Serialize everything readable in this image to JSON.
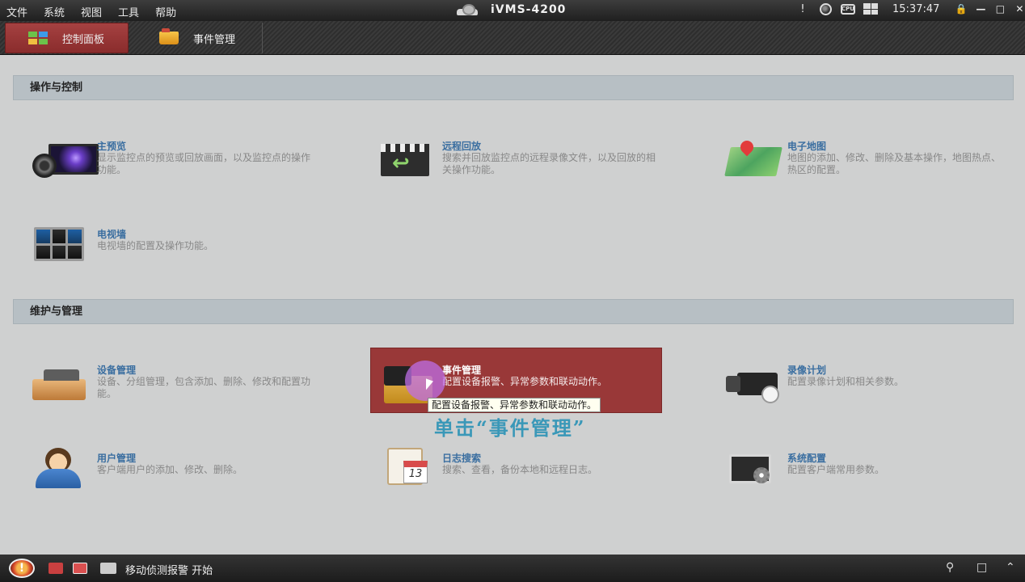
{
  "titlebar": {
    "menu": [
      "文件",
      "系统",
      "视图",
      "工具",
      "帮助"
    ],
    "app_name": "iVMS-4200",
    "alert_mark": "!",
    "cpu_label": "CPU",
    "time": "15:37:47"
  },
  "tabs": [
    {
      "label": "控制面板",
      "active": true,
      "icon": "grid-icon"
    },
    {
      "label": "事件管理",
      "active": false,
      "icon": "folder-icon"
    }
  ],
  "sections": [
    {
      "header": "操作与控制",
      "items": [
        {
          "title": "主预览",
          "desc": "显示监控点的预览或回放画面，以及监控点的操作功能。",
          "icon": "main-preview-icon"
        },
        {
          "title": "远程回放",
          "desc": "搜索并回放监控点的远程录像文件，以及回放的相关操作功能。",
          "icon": "remote-playback-icon"
        },
        {
          "title": "电子地图",
          "desc": "地图的添加、修改、删除及基本操作，地图热点、热区的配置。",
          "icon": "emap-icon"
        },
        {
          "title": "电视墙",
          "desc": "电视墙的配置及操作功能。",
          "icon": "tv-wall-icon"
        }
      ]
    },
    {
      "header": "维护与管理",
      "items": [
        {
          "title": "设备管理",
          "desc": "设备、分组管理，包含添加、删除、修改和配置功能。",
          "icon": "device-management-icon"
        },
        {
          "title": "事件管理",
          "desc": "配置设备报警、异常参数和联动动作。",
          "icon": "event-management-icon",
          "highlighted": true
        },
        {
          "title": "录像计划",
          "desc": "配置录像计划和相关参数。",
          "icon": "recording-schedule-icon"
        },
        {
          "title": "用户管理",
          "desc": "客户端用户的添加、修改、删除。",
          "icon": "user-management-icon"
        },
        {
          "title": "日志搜索",
          "desc": "搜索、查看，备份本地和远程日志。",
          "icon": "log-search-icon",
          "calendar_day": "13"
        },
        {
          "title": "系统配置",
          "desc": "配置客户端常用参数。",
          "icon": "system-config-icon"
        }
      ]
    }
  ],
  "tooltip": "配置设备报警、异常参数和联动动作。",
  "annotation": "单击“事件管理”",
  "statusbar": {
    "alarm_mark": "!",
    "message": "移动侦测报警 开始"
  },
  "colors": {
    "highlight": "#993838",
    "active_tab": "#a54141",
    "title_link": "#3a6ea0",
    "annotation": "#3a98b8"
  }
}
